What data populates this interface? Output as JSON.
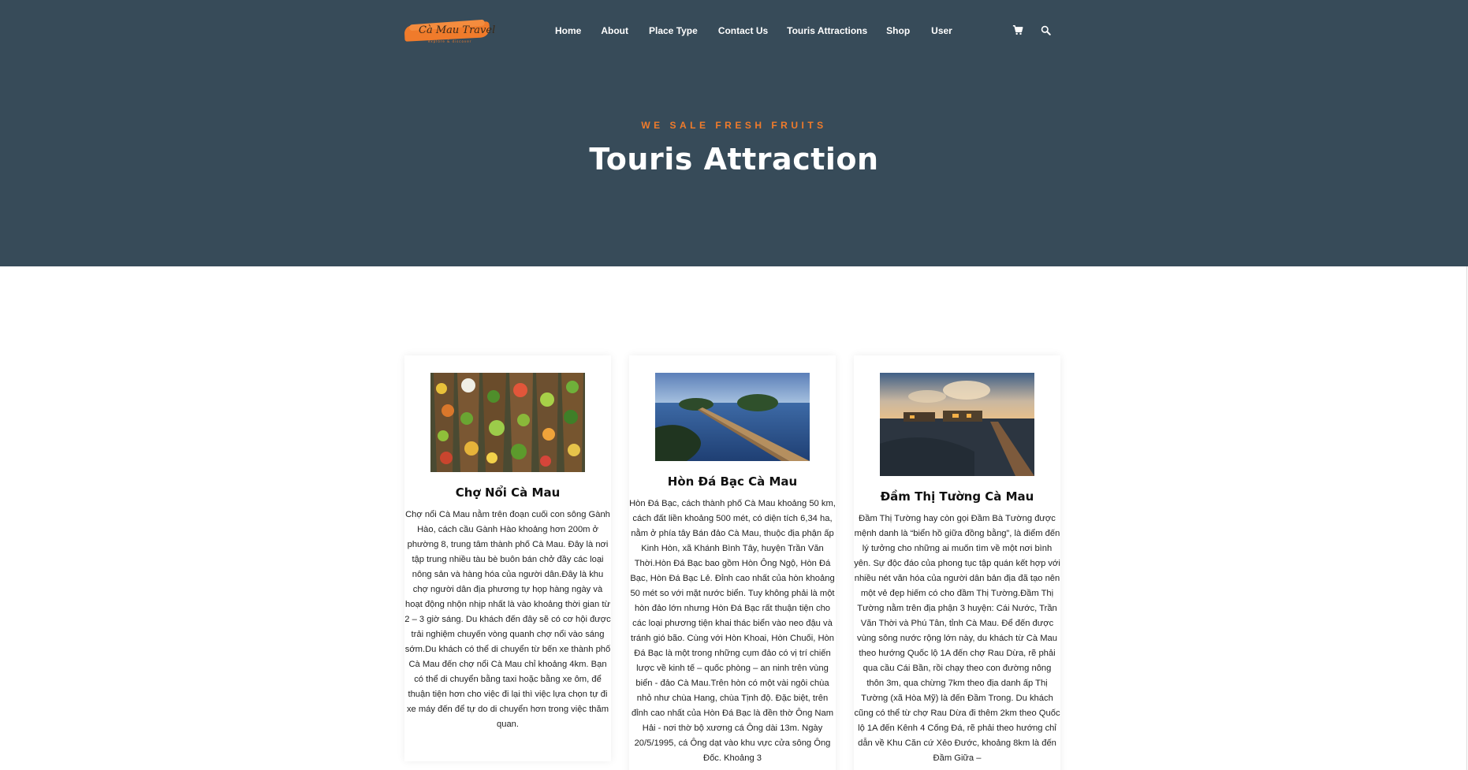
{
  "brand": {
    "logo_text": "Cà Mau Travel",
    "logo_tagline": "explore & discover"
  },
  "nav": {
    "items": [
      {
        "label": "Home"
      },
      {
        "label": "About"
      },
      {
        "label": "Place Type"
      },
      {
        "label": "Contact Us"
      },
      {
        "label": "Touris Attractions"
      },
      {
        "label": "Shop"
      },
      {
        "label": "User"
      }
    ],
    "icons": [
      "cart-icon",
      "search-icon"
    ]
  },
  "hero": {
    "subtitle": "WE SALE FRESH FRUITS",
    "title": "Touris Attraction"
  },
  "colors": {
    "header_bg": "#374b59",
    "accent": "#f07b2b",
    "text": "#222222"
  },
  "cards": [
    {
      "title": "Chợ Nổi Cà Mau",
      "text": "Chợ nổi Cà Mau nằm trên đoạn cuối con sông Gành Hào, cách cầu Gành Hào khoảng hơn 200m ở phường 8, trung tâm thành phố Cà Mau. Đây là nơi tập trung nhiều tàu bè buôn bán chở đầy các loại nông sản và hàng hóa của người dân.Đây là khu chợ người dân địa phương tự họp hàng ngày và hoạt động nhộn nhịp nhất là vào khoảng thời gian từ 2 – 3 giờ sáng. Du khách đến đây sẽ có cơ hội được trải nghiệm chuyến vòng quanh chợ nổi vào sáng sớm.Du khách có thể di chuyển từ bến xe thành phố Cà Mau đến chợ nổi Cà Mau chỉ khoảng 4km. Bạn có thể di chuyển bằng taxi hoặc bằng xe ôm, để thuận tiện hơn cho việc đi lại thì việc lựa chọn tự đi xe máy đến để tự do di chuyển hơn trong việc thăm quan."
    },
    {
      "title": "Hòn Đá Bạc Cà Mau",
      "text": "Hòn Đá Bạc, cách thành phố Cà Mau khoảng 50 km, cách đất liền khoảng 500 mét, có diện tích 6,34 ha, nằm ở phía tây Bán đảo Cà Mau, thuộc địa phận ấp Kinh Hòn, xã Khánh Bình Tây, huyện Trần Văn Thời.Hòn Đá Bạc bao gồm Hòn Ông Ngộ, Hòn Đá Bạc, Hòn Đá Bạc Lẻ. Đỉnh cao nhất của hòn khoảng 50 mét so với mặt nước biển. Tuy không phải là một hòn đảo lớn nhưng Hòn Đá Bạc rất thuận tiện cho các loại phương tiện khai thác biển vào neo đậu và tránh gió bão. Cùng với Hòn Khoai, Hòn Chuối, Hòn Đá Bạc là một trong những cụm đảo có vị trí chiến lược về kinh tế – quốc phòng – an ninh trên vùng biển - đảo Cà Mau.Trên hòn có một vài ngôi chùa nhỏ như chùa Hang, chùa Tịnh độ. Đặc biệt, trên đỉnh cao nhất của Hòn Đá Bạc là đền thờ Ông Nam Hải - nơi thờ bộ xương cá Ông dài 13m. Ngày 20/5/1995, cá Ông dạt vào khu vực cửa sông Ông Đốc. Khoảng 3"
    },
    {
      "title": "Đầm Thị Tường Cà Mau",
      "text": "Đầm Thị Tường hay còn gọi Đầm Bà Tường được mệnh danh là “biển hồ giữa đồng bằng”, là điểm đến lý tưởng cho những ai muốn tìm về một nơi bình yên. Sự độc đáo của phong tục tập quán kết hợp với nhiều nét văn hóa của người dân bản địa đã tạo nên một vẻ đẹp hiếm có cho đầm Thị Tường.Đầm Thị Tường nằm trên địa phận 3 huyện: Cái Nước, Trần Văn Thời và Phú Tân, tỉnh Cà Mau. Để đến được vùng sông nước rộng lớn này, du khách từ Cà Mau theo hướng Quốc lộ 1A đến chợ Rau Dừa, rẽ phải qua cầu Cái Bần, rồi chạy theo con đường nông thôn 3m, qua chừng 7km theo địa danh ấp Thị Tường (xã Hòa Mỹ) là đến Đầm Trong. Du khách cũng có thể từ chợ Rau Dừa đi thêm 2km theo Quốc lộ 1A đến Kênh 4 Cống Đá, rẽ phải theo hướng chỉ dẫn về Khu Căn cứ Xẻo Đước, khoảng 8km là đến Đầm Giữa –"
    }
  ]
}
